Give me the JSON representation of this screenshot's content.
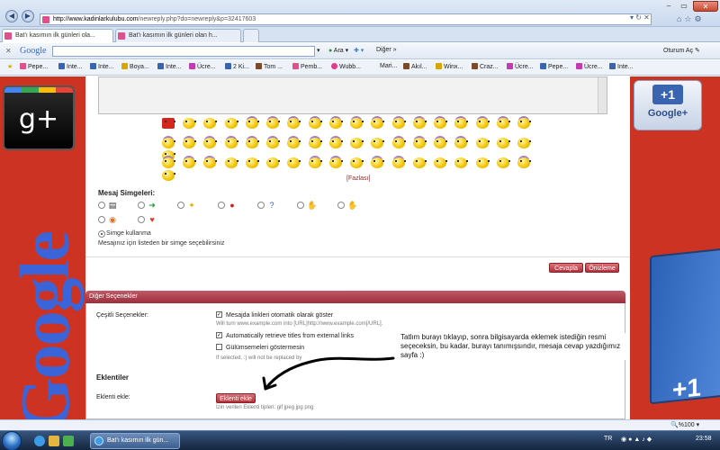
{
  "browser": {
    "url_host": "http://www.kadinlarkulubu.com",
    "url_path": "/newreply.php?do=newreply&p=32417603",
    "tabs": [
      {
        "label": "Bat'ı kasımın ilk günleri ola..."
      },
      {
        "label": "Bat'ı kasımın ilk günleri olan h..."
      }
    ],
    "window_close": "✕"
  },
  "google_toolbar": {
    "logo": "Google",
    "ara": "Ara",
    "diger": "Diğer",
    "oturum": "Oturum Aç"
  },
  "favorites": [
    "Pepe...",
    "Inte...",
    "Inte...",
    "Boya...",
    "Inte...",
    "Ücre...",
    "2 Ki...",
    "Tom ...",
    "Pemb...",
    "Wubb...",
    "Mari...",
    "Akıl...",
    "Winx...",
    "Craz...",
    "Ücre...",
    "Pepe...",
    "Ücre...",
    "Inte..."
  ],
  "banners": {
    "left_gplus": "g+",
    "left_vertical": "Google",
    "right_plus1": "+1",
    "right_google_plus": "Google+",
    "right_book": "+1"
  },
  "editor": {
    "fazlasi": "[Fazlası]",
    "mesaj_simgeleri": "Mesaj Simgeleri:",
    "simge_kullanma": "Simge kullanma",
    "simge_hint": "Mesajınız için listeden bir simge seçebilirsiniz",
    "btn_cevapla": "Cevapla",
    "btn_onizleme": "Önizleme"
  },
  "options": {
    "header": "Diğer Seçenekler",
    "cesitli_label": "Çeşitli Seçenekler:",
    "opt1": "Mesajda linkleri otomatik olarak göster",
    "opt1_hint": "Will turn www.example.com into [URL]http://www.example.com[/URL].",
    "opt2": "Automatically retrieve titles from external links",
    "opt3": "Gülümsemeleri göstermesin",
    "opt3_hint": "If selected, :) will not be replaced by",
    "check": "✓",
    "eklentiler": "Eklentiler",
    "eklenti_ekle_label": "Eklenti ekle:",
    "eklenti_ekle_btn": "Eklenti ekle",
    "eklenti_types": "İzin verilen Eklenti tipleri: gif jpeg jpg png"
  },
  "annotation": {
    "text": "Tatlım burayı tıklayıp, sonra bilgisayarda eklemek istediğin resmi seçeceksin, bu kadar, burayı tanımışsındır, mesaja cevap yazdığımız sayfa :)"
  },
  "status": {
    "zoom": "%100"
  },
  "taskbar": {
    "item": "Bat'ı kasımın ilk gün...",
    "lang": "TR",
    "time": "23:58"
  }
}
